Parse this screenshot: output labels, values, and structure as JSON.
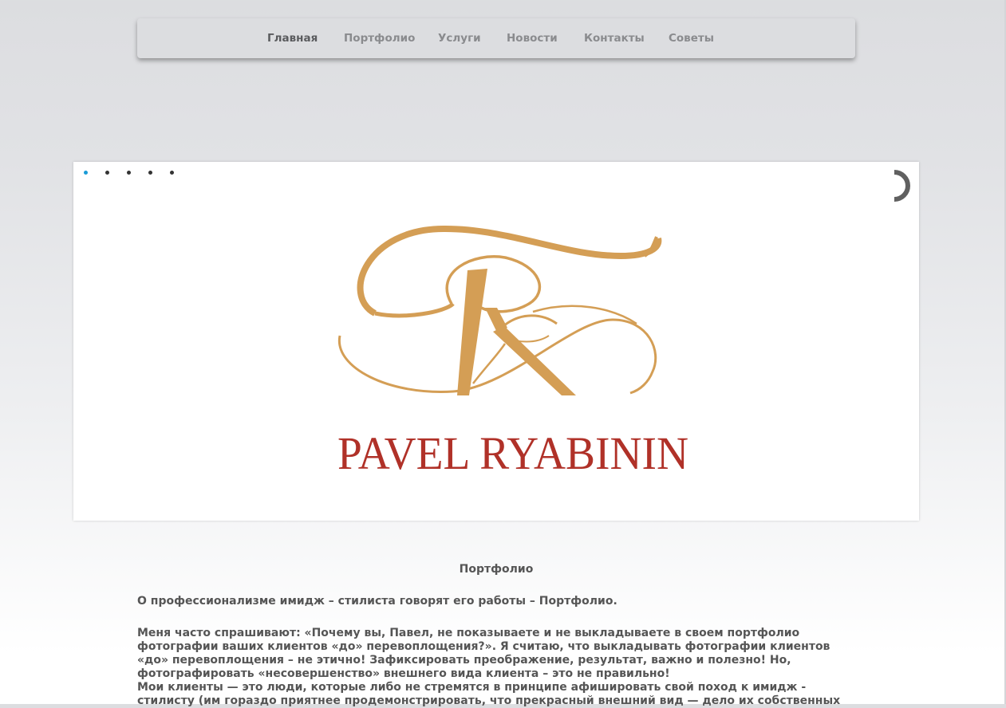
{
  "nav": {
    "items": [
      "Главная",
      "Портфолио",
      "Услуги",
      "Новости",
      "Контакты",
      "Советы"
    ],
    "active_index": 0
  },
  "slider": {
    "slide_count": 5,
    "active_slide": 0,
    "logo_text": "PAVEL RYABININ",
    "colors": {
      "monogram": "#d49e55",
      "wordmark": "#b03128",
      "active_dot": "#1a9bd7"
    }
  },
  "content": {
    "title": "Портфолио",
    "lead": "О профессионализме имидж – стилиста говорят его работы – Портфолио.",
    "paragraph1": "Меня часто спрашивают: «Почему вы, Павел, не показываете и не выкладываете в своем портфолио фотографии ваших клиентов «до» перевоплощения?». Я считаю, что выкладывать фотографии клиентов «до» перевоплощения – не этично! Зафиксировать преображение, результат, важно и полезно! Но, фотографировать «несовершенство» внешнего вида клиента – это не правильно!",
    "paragraph2": "Мои клиенты — это люди, которые либо не стремятся в принципе афишировать свой поход к имидж - стилисту (им гораздо приятнее продемонстрировать, что прекрасный внешний вид — дело их собственных"
  }
}
